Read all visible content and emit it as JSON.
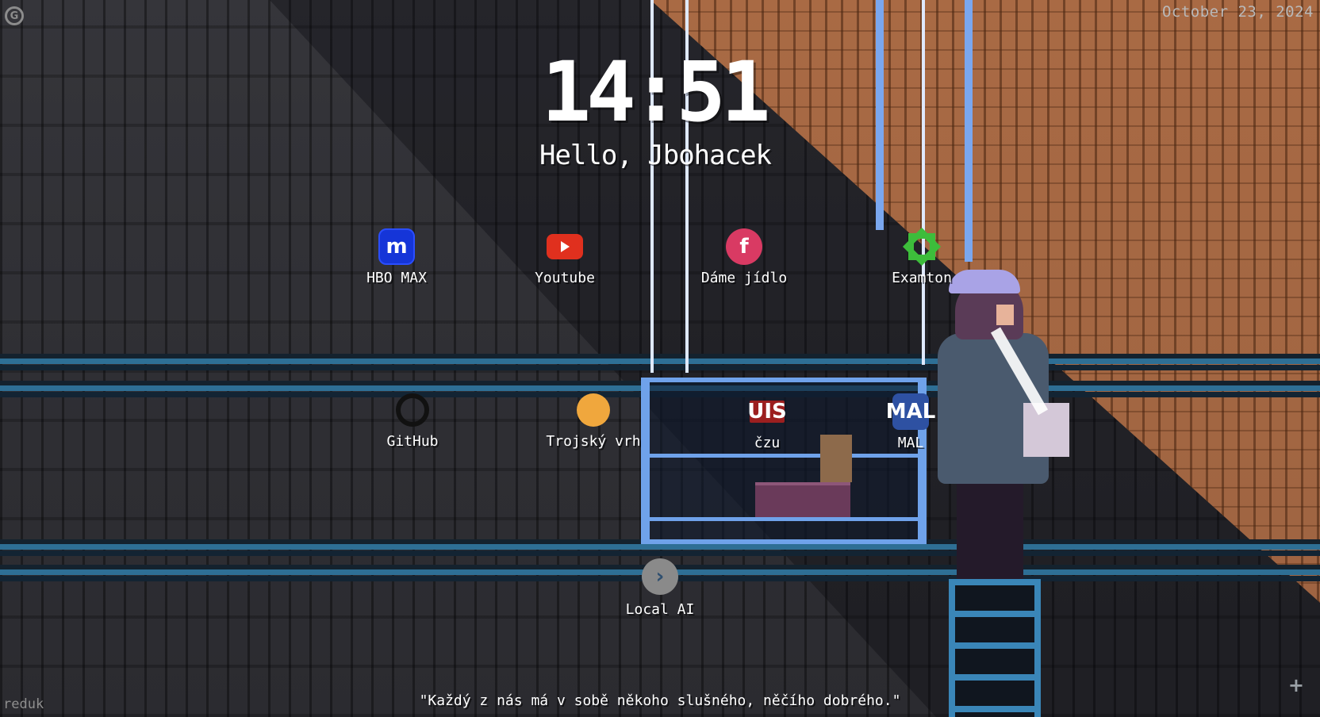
{
  "header": {
    "corner_icon": "G",
    "date": "October 23, 2024"
  },
  "clock": {
    "time": "14:51",
    "greeting": "Hello, Jbohacek"
  },
  "shortcuts": [
    {
      "label": "HBO MAX",
      "icon": "m",
      "icon_name": "hbo-max-icon",
      "color": "#1535d8"
    },
    {
      "label": "Youtube",
      "icon": "",
      "icon_name": "youtube-icon",
      "color": "#e0301e"
    },
    {
      "label": "Dáme jídlo",
      "icon": "f",
      "icon_name": "dame-jidlo-icon",
      "color": "#d93a63"
    },
    {
      "label": "Examton",
      "icon": "",
      "icon_name": "examton-icon",
      "color": "#3dbd3b"
    },
    {
      "label": "GitHub",
      "icon": "",
      "icon_name": "github-icon",
      "color": "#111111"
    },
    {
      "label": "Trojský vrh",
      "icon": "",
      "icon_name": "trojsky-vrh-icon",
      "color": "#f0a73d"
    },
    {
      "label": "čzu",
      "icon": "UIS",
      "icon_name": "uis-icon",
      "color": "#9c1f1f"
    },
    {
      "label": "MAL",
      "icon": "MAL",
      "icon_name": "mal-icon",
      "color": "#2e51a2"
    },
    {
      "label": "Local AI",
      "icon": "›",
      "icon_name": "chevron-right-icon",
      "color": "#8a8a8a"
    }
  ],
  "footer": {
    "left_text": "reduk",
    "quote": "\"Každý z nás má v sobě někoho slušného, něčího dobrého.\"",
    "add_icon": "+"
  }
}
